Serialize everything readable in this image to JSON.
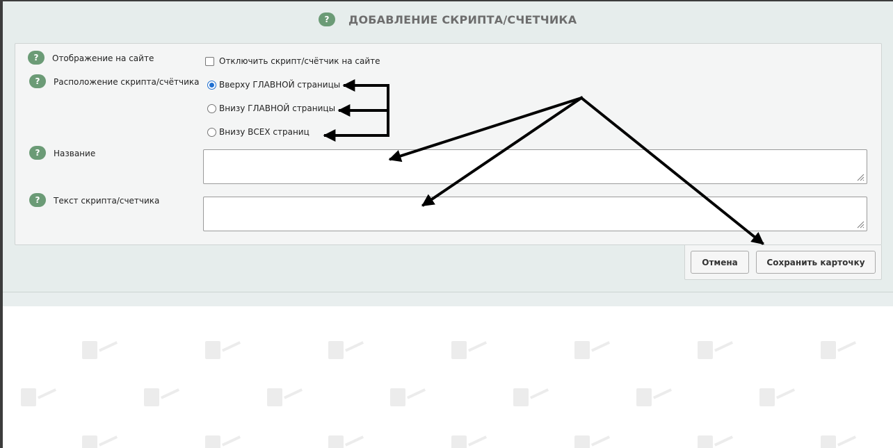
{
  "dialog": {
    "title": "ДОБАВЛЕНИЕ СКРИПТА/СЧЕТЧИКА",
    "help_symbol": "?"
  },
  "form": {
    "display": {
      "label": "Отображение на сайте",
      "checkbox_label": "Отключить скрипт/счётчик на сайте",
      "checked": false
    },
    "location": {
      "label": "Расположение скрипта/счётчика",
      "options": [
        {
          "label": "Вверху ГЛАВНОЙ страницы",
          "selected": true
        },
        {
          "label": "Внизу ГЛАВНОЙ страницы",
          "selected": false
        },
        {
          "label": "Внизу ВСЕХ страниц",
          "selected": false
        }
      ]
    },
    "name": {
      "label": "Название",
      "value": ""
    },
    "script_text": {
      "label": "Текст скрипта/счетчика",
      "value": ""
    }
  },
  "actions": {
    "cancel_label": "Отмена",
    "save_label": "Сохранить карточку"
  },
  "colors": {
    "help_badge": "#6b9b76",
    "panel_bg": "#e6edec",
    "radio_accent": "#1f6fd1",
    "annotation_arrows": "#000000"
  }
}
